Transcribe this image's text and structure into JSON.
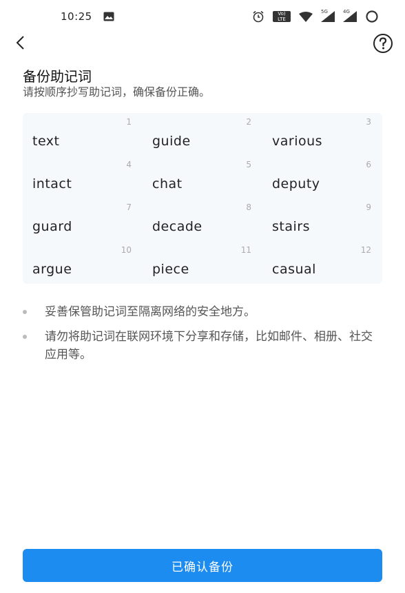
{
  "status_bar": {
    "time": "10:25",
    "volte_label": "Vo) LTE",
    "signal_1_label": "5G",
    "signal_2_label": "4G"
  },
  "nav": {
    "back_icon": "chevron-left-icon",
    "help_icon": "question-circle-icon"
  },
  "header": {
    "title": "备份助记词",
    "subtitle": "请按顺序抄写助记词，确保备份正确。"
  },
  "mnemonic": [
    {
      "num": "1",
      "word": "text"
    },
    {
      "num": "2",
      "word": "guide"
    },
    {
      "num": "3",
      "word": "various"
    },
    {
      "num": "4",
      "word": "intact"
    },
    {
      "num": "5",
      "word": "chat"
    },
    {
      "num": "6",
      "word": "deputy"
    },
    {
      "num": "7",
      "word": "guard"
    },
    {
      "num": "8",
      "word": "decade"
    },
    {
      "num": "9",
      "word": "stairs"
    },
    {
      "num": "10",
      "word": "argue"
    },
    {
      "num": "11",
      "word": "piece"
    },
    {
      "num": "12",
      "word": "casual"
    }
  ],
  "tips": [
    "妥善保管助记词至隔离网络的安全地方。",
    "请勿将助记词在联网环境下分享和存储，比如邮件、相册、社交应用等。"
  ],
  "confirm_button": {
    "label": "已确认备份",
    "color": "#1d8cf0"
  }
}
